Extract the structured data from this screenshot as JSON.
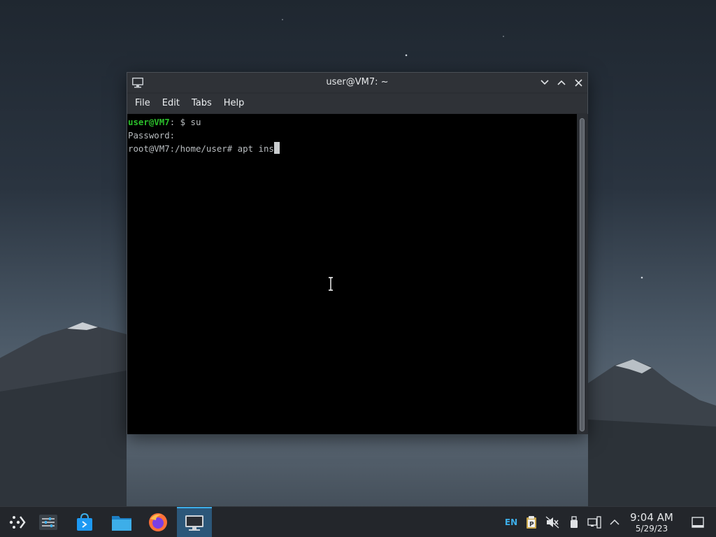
{
  "window": {
    "title": "user@VM7: ~",
    "menu": [
      "File",
      "Edit",
      "Tabs",
      "Help"
    ]
  },
  "terminal": {
    "line1_user": "user@VM7",
    "line1_rest": ": $ su",
    "line2": "Password:",
    "line3": "root@VM7:/home/user# apt ins"
  },
  "taskbar": {
    "language": "EN",
    "time": "9:04 AM",
    "date": "5/29/23",
    "icons": [
      "app-launcher-icon",
      "settings-sliders-icon",
      "software-center-icon",
      "file-manager-icon",
      "firefox-icon",
      "terminal-icon"
    ],
    "tray_icons": [
      "clipboard-icon",
      "volume-muted-icon",
      "usb-drive-icon",
      "network-icon",
      "chevron-up-icon",
      "show-desktop-icon"
    ]
  },
  "colors": {
    "accent": "#3daee9",
    "prompt_green": "#2bbf2b",
    "terminal_bg": "#000000"
  }
}
